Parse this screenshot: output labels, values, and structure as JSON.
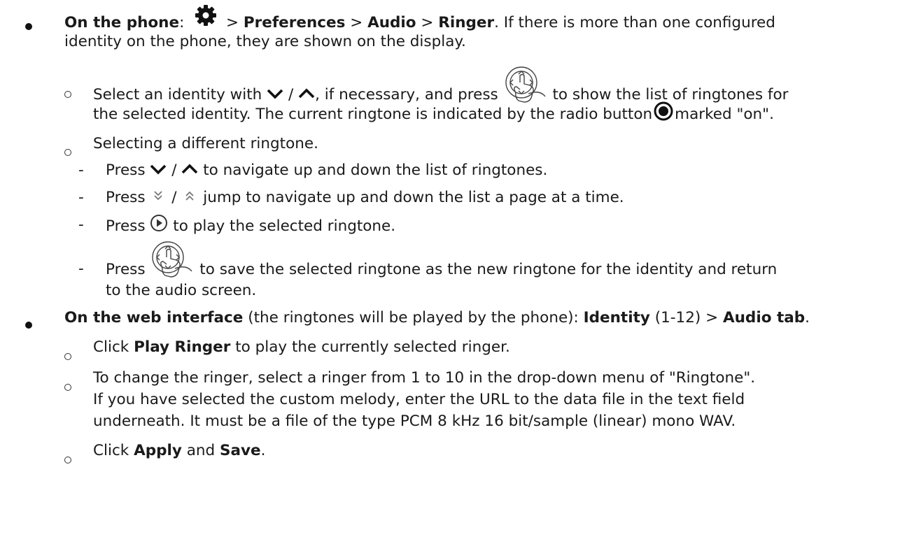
{
  "doc": {
    "s1": {
      "title": "On the phone",
      "colon": ":",
      "sep1": ">",
      "pref": "Preferences",
      "sep2": ">",
      "audio": "Audio",
      "sep3": ">",
      "ringer": "Ringer",
      "tail1": ". If there is more than one configured",
      "line2": "identity on the phone, they are shown on the display."
    },
    "s1a": {
      "t1": "Select an identity with",
      "slash": "/",
      "t2": ", if necessary, and press",
      "t3": "to show the list of ringtones for",
      "line2a": "the selected identity.  The current ringtone is indicated by the radio button",
      "line2b": "marked \"on\"."
    },
    "s1b": {
      "text": "Selecting a different ringtone.",
      "d1a": "Press",
      "d1slash": "/",
      "d1b": "to navigate up and down the list of ringtones.",
      "d2a": "Press",
      "d2slash": "/",
      "d2b": "jump to navigate up and down the list a page at a time.",
      "d3a": "Press",
      "d3b": "to play the selected ringtone.",
      "d4a": "Press",
      "d4b": "to save the selected ringtone as the new ringtone for the identity and return",
      "d4c": "to the audio screen."
    },
    "s2": {
      "title": "On the web interface",
      "t1": "(the ringtones will be played by the phone):",
      "identity": "Identity",
      "t2": "(1-12) >",
      "audiotab": "Audio tab",
      "end": ".",
      "a1": "Click",
      "a1b": "Play Ringer",
      "a1c": "to play the currently selected ringer.",
      "b1": "To change the ringer, select a ringer from 1 to 10 in the drop-down menu of \"Ringtone\".",
      "b2": "If you have selected the custom melody, enter the URL to the data file in the text field",
      "b3": "underneath.  It must be a file of the type PCM 8 kHz 16 bit/sample (linear) mono WAV.",
      "c1": "Click",
      "apply": "Apply",
      "and": "and",
      "save": "Save",
      "cend": "."
    }
  }
}
